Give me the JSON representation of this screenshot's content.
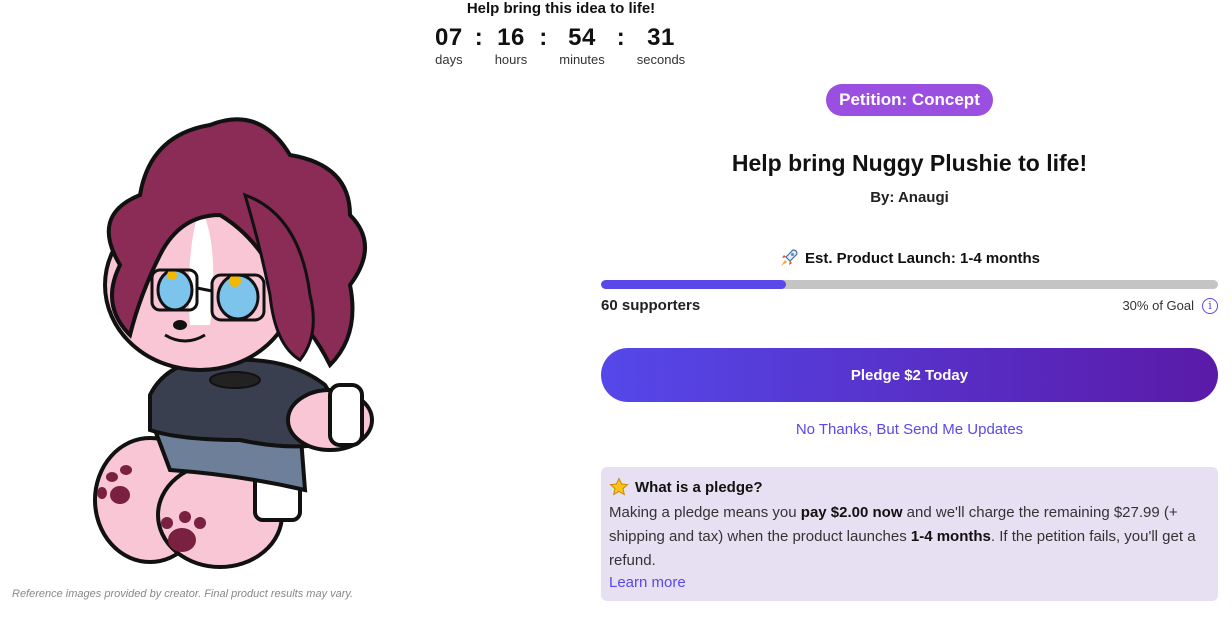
{
  "countdown": {
    "title": "Help bring this idea to life!",
    "units": [
      {
        "value": "07",
        "label": "days"
      },
      {
        "value": "16",
        "label": "hours"
      },
      {
        "value": "54",
        "label": "minutes"
      },
      {
        "value": "31",
        "label": "seconds"
      }
    ],
    "separator": ":"
  },
  "product_image": {
    "icon": "plush-character-illustration",
    "disclaimer": "Reference images provided by creator. Final product results may vary."
  },
  "campaign": {
    "status_pill": "Petition: Concept",
    "title": "Help bring Nuggy Plushie to life!",
    "byline": "By: Anaugi",
    "launch_icon": "rocket-icon",
    "launch_text": "Est. Product Launch: 1-4 months",
    "progress_percent": 30,
    "supporters_text": "60 supporters",
    "goal_text": "30% of Goal",
    "info_icon": "i",
    "pledge_button": "Pledge $2 Today",
    "updates_link": "No Thanks, But Send Me Updates"
  },
  "pledge_info": {
    "icon": "star-icon",
    "heading": "What is a pledge?",
    "body_1": "Making a pledge means you ",
    "body_bold_1": "pay $2.00 now",
    "body_2": " and we'll charge the remaining $27.99 (+ shipping and tax) when the product launches ",
    "body_bold_2": "1-4 months",
    "body_3": ". If the petition fails, you'll get a refund.",
    "learn_more": "Learn more"
  },
  "colors": {
    "accent": "#5b48e8",
    "pill": "#9b4fe0",
    "hair": "#8a2c55",
    "info_bg": "#e6e0f2"
  }
}
